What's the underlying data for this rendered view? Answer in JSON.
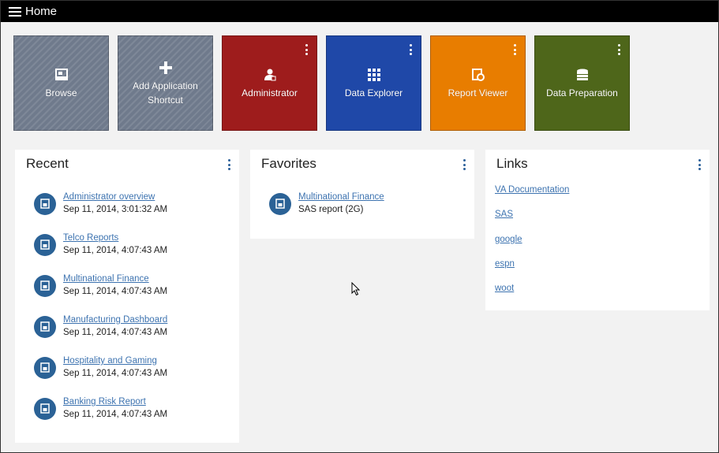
{
  "topbar": {
    "title": "Home",
    "menu_icon": "hamburger-icon"
  },
  "tiles": [
    {
      "label": "Browse",
      "icon": "browse-icon",
      "color": "#6f7a8c",
      "menu": false
    },
    {
      "label": "Add Application Shortcut",
      "icon": "plus-icon",
      "color": "#6f7a8c",
      "menu": false
    },
    {
      "label": "Administrator",
      "icon": "user-admin-icon",
      "color": "#9e1c1c",
      "menu": true
    },
    {
      "label": "Data Explorer",
      "icon": "grid-icon",
      "color": "#1f48a8",
      "menu": true
    },
    {
      "label": "Report Viewer",
      "icon": "report-icon",
      "color": "#e87d00",
      "menu": true
    },
    {
      "label": "Data Preparation",
      "icon": "database-icon",
      "color": "#4e661a",
      "menu": true
    }
  ],
  "recent": {
    "title": "Recent",
    "items": [
      {
        "name": "Administrator overview",
        "date": "Sep 11, 2014, 3:01:32 AM"
      },
      {
        "name": "Telco Reports",
        "date": "Sep 11, 2014, 4:07:43 AM"
      },
      {
        "name": "Multinational Finance",
        "date": "Sep 11, 2014, 4:07:43 AM"
      },
      {
        "name": "Manufacturing Dashboard",
        "date": "Sep 11, 2014, 4:07:43 AM"
      },
      {
        "name": "Hospitality and Gaming",
        "date": "Sep 11, 2014, 4:07:43 AM"
      },
      {
        "name": "Banking Risk Report",
        "date": "Sep 11, 2014, 4:07:43 AM"
      }
    ]
  },
  "favorites": {
    "title": "Favorites",
    "items": [
      {
        "name": "Multinational Finance",
        "detail": "SAS report (2G)"
      }
    ]
  },
  "links": {
    "title": "Links",
    "items": [
      "VA Documentation",
      "SAS",
      "google",
      "espn",
      "woot"
    ]
  },
  "colors": {
    "accent": "#2b6296",
    "link": "#3d73b0",
    "topbar": "#000000"
  }
}
